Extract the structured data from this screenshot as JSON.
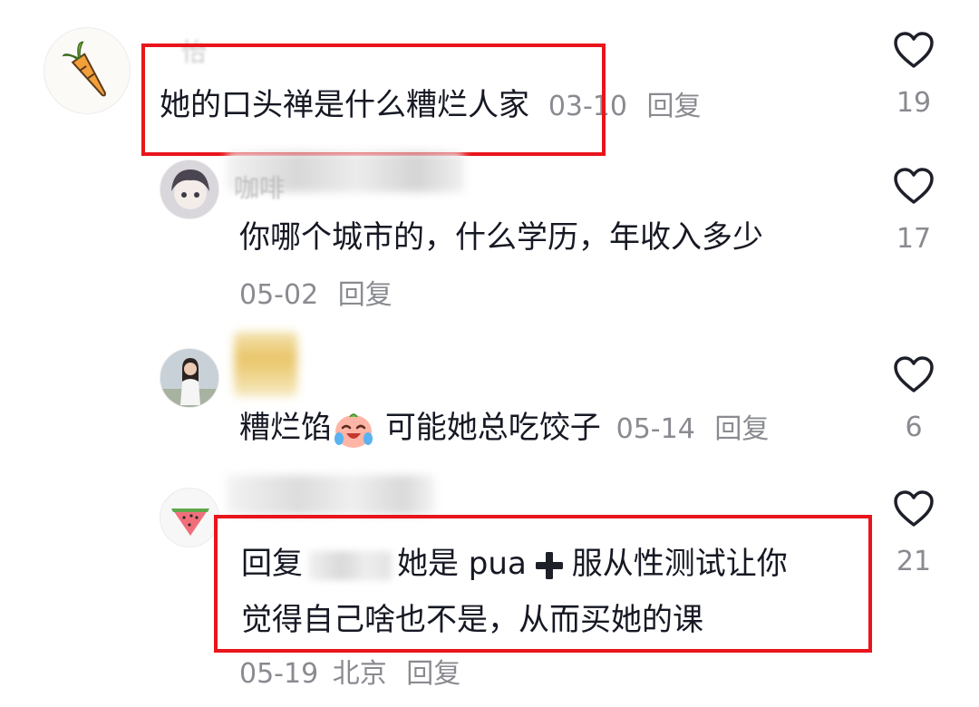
{
  "colors": {
    "highlight": "#e8151b",
    "meta": "#8a8b91",
    "text": "#161823"
  },
  "comments": [
    {
      "username_partial": "怡",
      "text": "她的口头禅是什么糟烂人家",
      "date": "03-10",
      "reply_label": "回复",
      "likes": "19",
      "highlighted": true
    },
    {
      "username_partial": "咖啡",
      "text": "你哪个城市的，什么学历，年收入多少",
      "date": "05-02",
      "reply_label": "回复",
      "likes": "17"
    },
    {
      "text_before": "糟烂馅",
      "emoji": "crying-laughing-face",
      "text_after": "可能她总吃饺子",
      "date": "05-14",
      "reply_label": "回复",
      "likes": "6"
    },
    {
      "reply_prefix": "回复",
      "text_part1": "她是 pua",
      "icon": "heavy-plus-icon",
      "text_part2": "服从性测试让你",
      "text_line2": "觉得自己啥也不是，从而买她的课",
      "date": "05-19",
      "location": "北京",
      "reply_label": "回复",
      "likes": "21",
      "highlighted": true
    }
  ]
}
